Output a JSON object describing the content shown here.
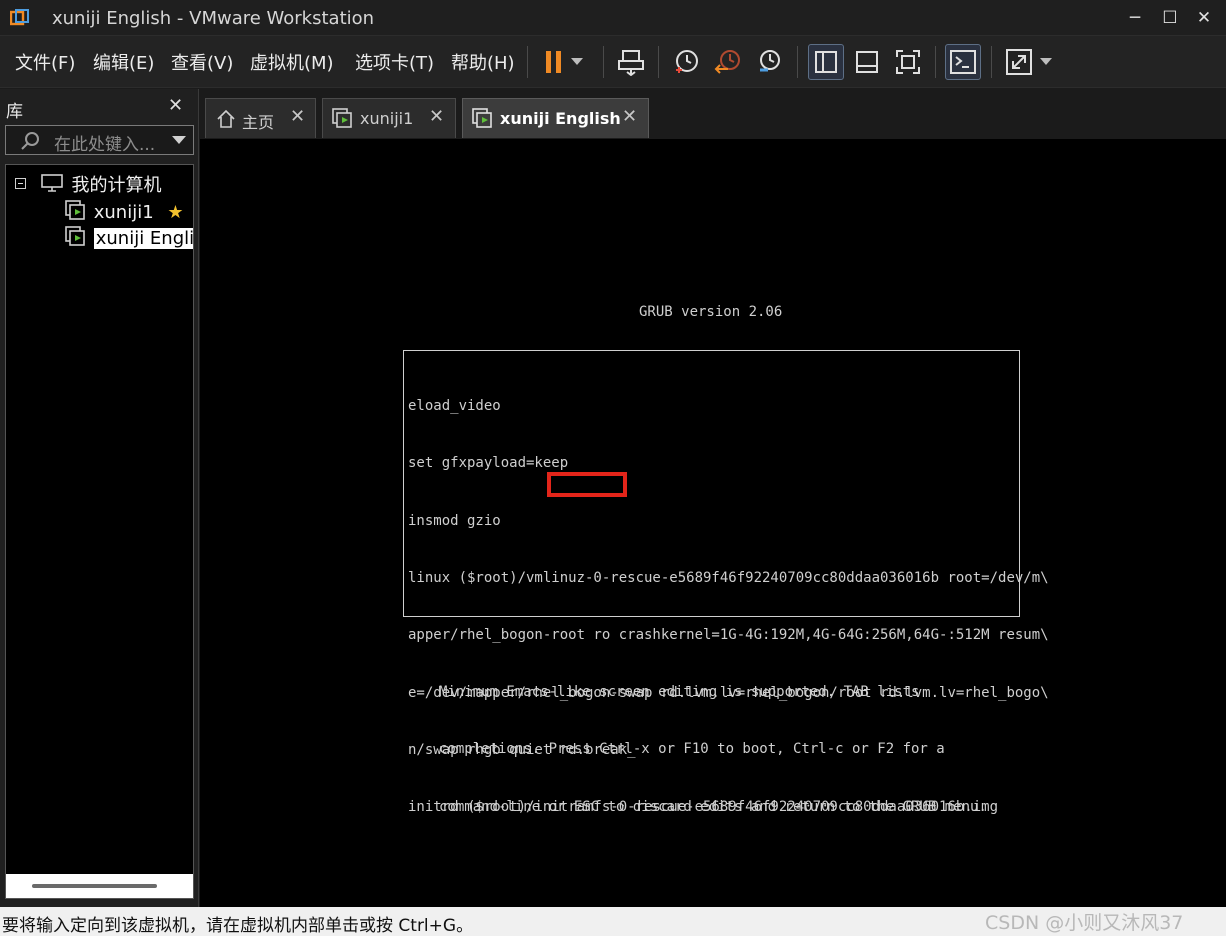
{
  "window": {
    "title": "xuniji English - VMware Workstation",
    "controls": {
      "minimize": "─",
      "maximize": "☐",
      "close": "✕"
    },
    "app_icon": "vmware-icon"
  },
  "menu": [
    "文件(F)",
    "编辑(E)",
    "查看(V)",
    "虚拟机(M)",
    "选项卡(T)",
    "帮助(H)"
  ],
  "toolbar": [
    {
      "name": "pause-button",
      "icon": "pause-icon"
    },
    {
      "name": "pause-dropdown",
      "icon": "chevron-down-icon"
    },
    {
      "name": "send-ctrl-alt-del-button",
      "icon": "send-keys-icon"
    },
    {
      "name": "snapshot-button",
      "icon": "snapshot-icon"
    },
    {
      "name": "revert-snapshot-button",
      "icon": "revert-icon"
    },
    {
      "name": "snapshot-manager-button",
      "icon": "snapshot-manager-icon"
    },
    {
      "name": "show-library-button",
      "icon": "library-icon",
      "active": true
    },
    {
      "name": "thumbnail-bar-button",
      "icon": "thumbnail-icon"
    },
    {
      "name": "full-screen-button",
      "icon": "fullscreen-icon"
    },
    {
      "name": "console-view-button",
      "icon": "console-icon",
      "active": true
    },
    {
      "name": "stretch-guest-button",
      "icon": "stretch-icon"
    },
    {
      "name": "stretch-dropdown",
      "icon": "chevron-down-icon"
    }
  ],
  "library": {
    "title": "库",
    "close": "✕",
    "search_placeholder": "在此处键入...",
    "tree": {
      "root": "我的计算机",
      "items": [
        {
          "label": "xuniji1",
          "favorite": true
        },
        {
          "label": "xuniji Englis",
          "selected": true
        }
      ]
    }
  },
  "tabs": [
    {
      "label": "主页",
      "icon": "home-icon",
      "close": "✕"
    },
    {
      "label": "xuniji1",
      "icon": "vm-icon",
      "close": "✕"
    },
    {
      "label": "xuniji English",
      "icon": "vm-icon",
      "close": "✕",
      "active": true
    }
  ],
  "console": {
    "grub_version": "GRUB version 2.06",
    "lines": [
      "eload_video",
      "set gfxpayload=keep",
      "insmod gzio",
      "linux ($root)/vmlinuz-0-rescue-e5689f46f92240709cc80ddaa036016b root=/dev/m\\",
      "apper/rhel_bogon-root ro crashkernel=1G-4G:192M,4G-64G:256M,64G-:512M resum\\",
      "e=/dev/mapper/rhel_bogon-swap rd.lvm.lv=rhel_bogon/root rd.lvm.lv=rhel_bogo\\",
      "n/swap rhgb quiet rd.break_",
      "initrd ($root)/initramfs-0-rescue-e5689f46f92240709cc80ddaa036016b.img"
    ],
    "help": [
      "Minimum Emacs-like screen editing is supported. TAB lists",
      "completions. Press Ctrl-x or F10 to boot, Ctrl-c or F2 for a",
      "command-line or ESC to discard edits and return to the GRUB menu."
    ],
    "highlight_color": "#e3251a"
  },
  "status": {
    "text": "要将输入定向到该虚拟机，请在虚拟机内部单击或按 Ctrl+G。",
    "watermark": "CSDN @小则又沐风37"
  },
  "colors": {
    "accent_orange": "#f08a24",
    "console_text": "#cfcfcf"
  }
}
